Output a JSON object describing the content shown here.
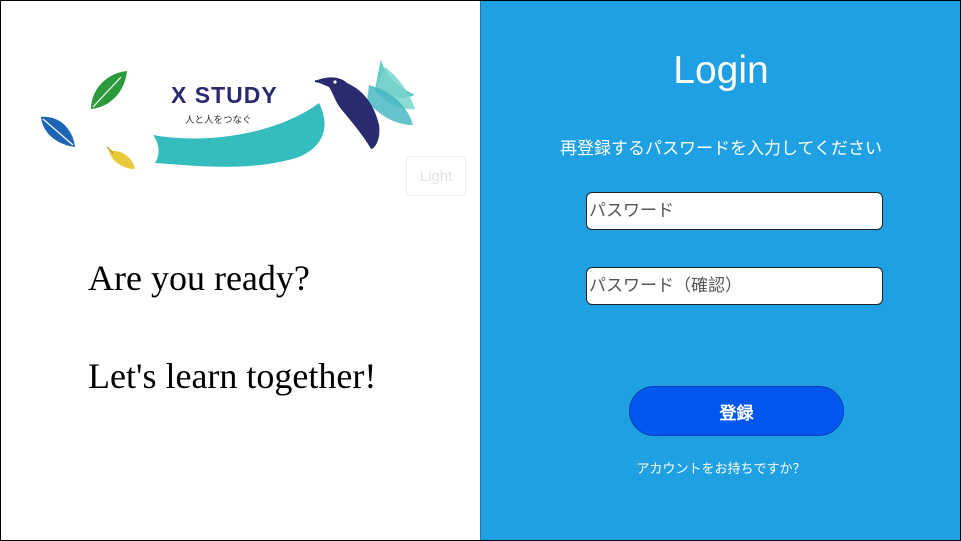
{
  "left": {
    "logo": {
      "brand": "X STUDY",
      "slogan": "人と人をつなぐ"
    },
    "theme_toggle_label": "Light",
    "tagline_1": "Are you ready?",
    "tagline_2": "Let's learn together!"
  },
  "right": {
    "title": "Login",
    "instruction": "再登録するパスワードを入力してください",
    "password_placeholder": "パスワード",
    "password_confirm_placeholder": "パスワード（確認）",
    "submit_label": "登録",
    "account_link": "アカウントをお持ちですか？"
  },
  "colors": {
    "panel_bg": "#1fa0e2",
    "button_bg": "#0057f0",
    "logo_navy": "#2a2a6e",
    "logo_teal": "#35bcbc"
  }
}
